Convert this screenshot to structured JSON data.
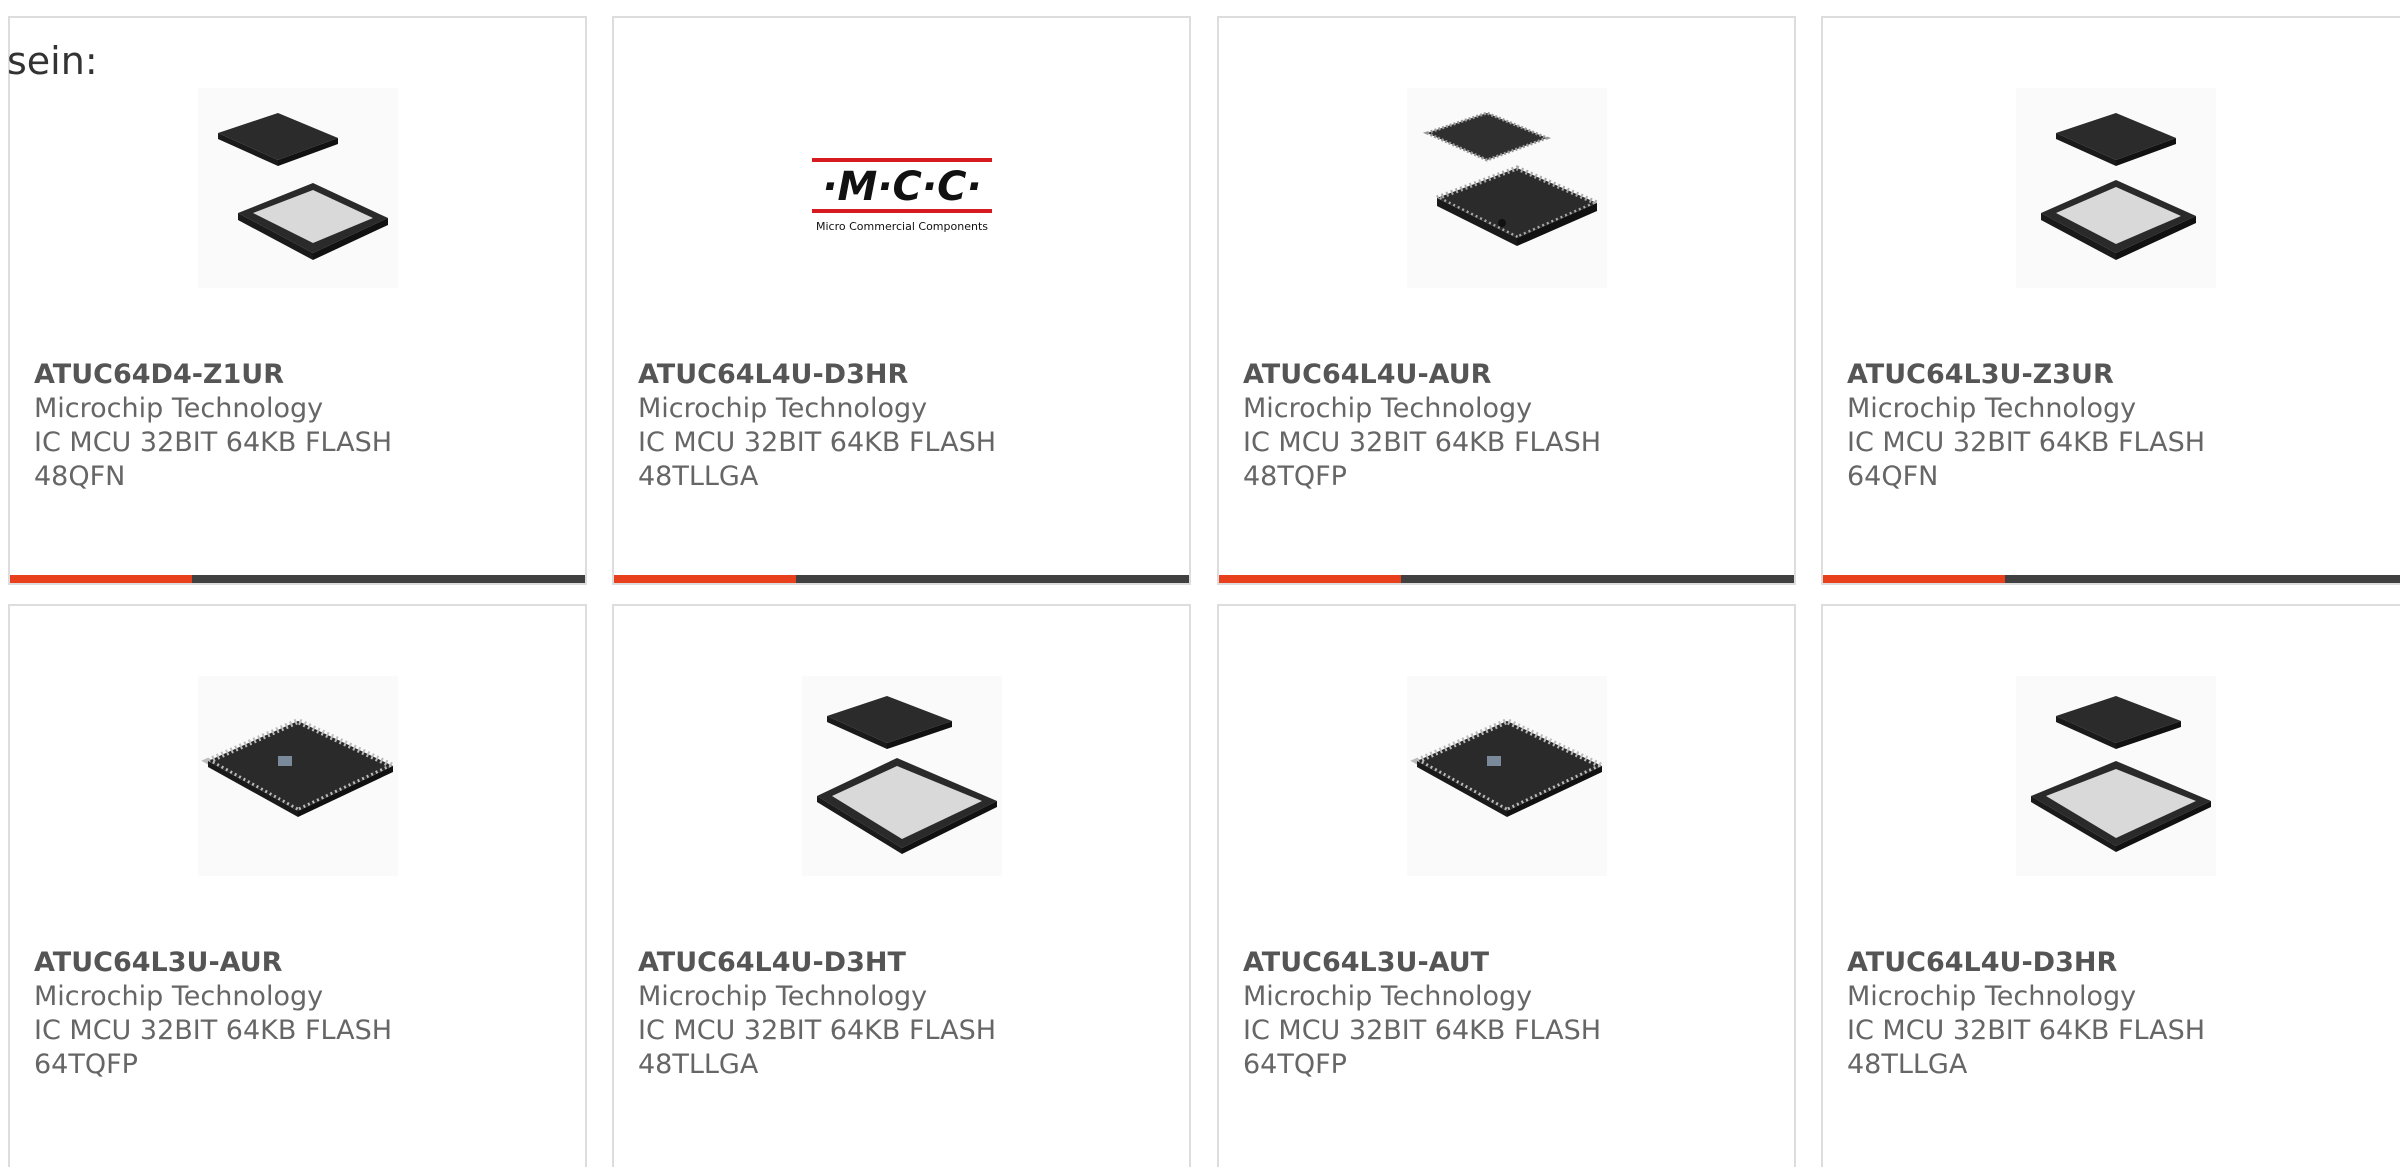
{
  "intro_text": "sein:",
  "colors": {
    "accent": "#e8401c",
    "bar": "#404040",
    "border": "#dddddd",
    "text": "#666666"
  },
  "products": [
    {
      "part": "ATUC64D4-Z1UR",
      "maker": "Microchip Technology",
      "desc": "IC MCU 32BIT 64KB FLASH",
      "package": "48QFN",
      "image": "qfn-chip-image"
    },
    {
      "part": "ATUC64L4U-D3HR",
      "maker": "Microchip Technology",
      "desc": "IC MCU 32BIT 64KB FLASH",
      "package": "48TLLGA",
      "image": "mcc-logo"
    },
    {
      "part": "ATUC64L4U-AUR",
      "maker": "Microchip Technology",
      "desc": "IC MCU 32BIT 64KB FLASH",
      "package": "48TQFP",
      "image": "tqfp-chip-image"
    },
    {
      "part": "ATUC64L3U-Z3UR",
      "maker": "Microchip Technology",
      "desc": "IC MCU 32BIT 64KB FLASH",
      "package": "64QFN",
      "image": "qfn-chip-image"
    },
    {
      "part": "ATUC64L3U-AUR",
      "maker": "Microchip Technology",
      "desc": "IC MCU 32BIT 64KB FLASH",
      "package": "64TQFP",
      "image": "tqfp-chip-image"
    },
    {
      "part": "ATUC64L4U-D3HT",
      "maker": "Microchip Technology",
      "desc": "IC MCU 32BIT 64KB FLASH",
      "package": "48TLLGA",
      "image": "qfn-chip-image"
    },
    {
      "part": "ATUC64L3U-AUT",
      "maker": "Microchip Technology",
      "desc": "IC MCU 32BIT 64KB FLASH",
      "package": "64TQFP",
      "image": "tqfp-chip-image"
    },
    {
      "part": "ATUC64L4U-D3HR",
      "maker": "Microchip Technology",
      "desc": "IC MCU 32BIT 64KB FLASH",
      "package": "48TLLGA",
      "image": "qfn-chip-image"
    }
  ],
  "mcc_logo": {
    "letters": "·M·C·C·",
    "tagline": "Micro Commercial Components"
  }
}
